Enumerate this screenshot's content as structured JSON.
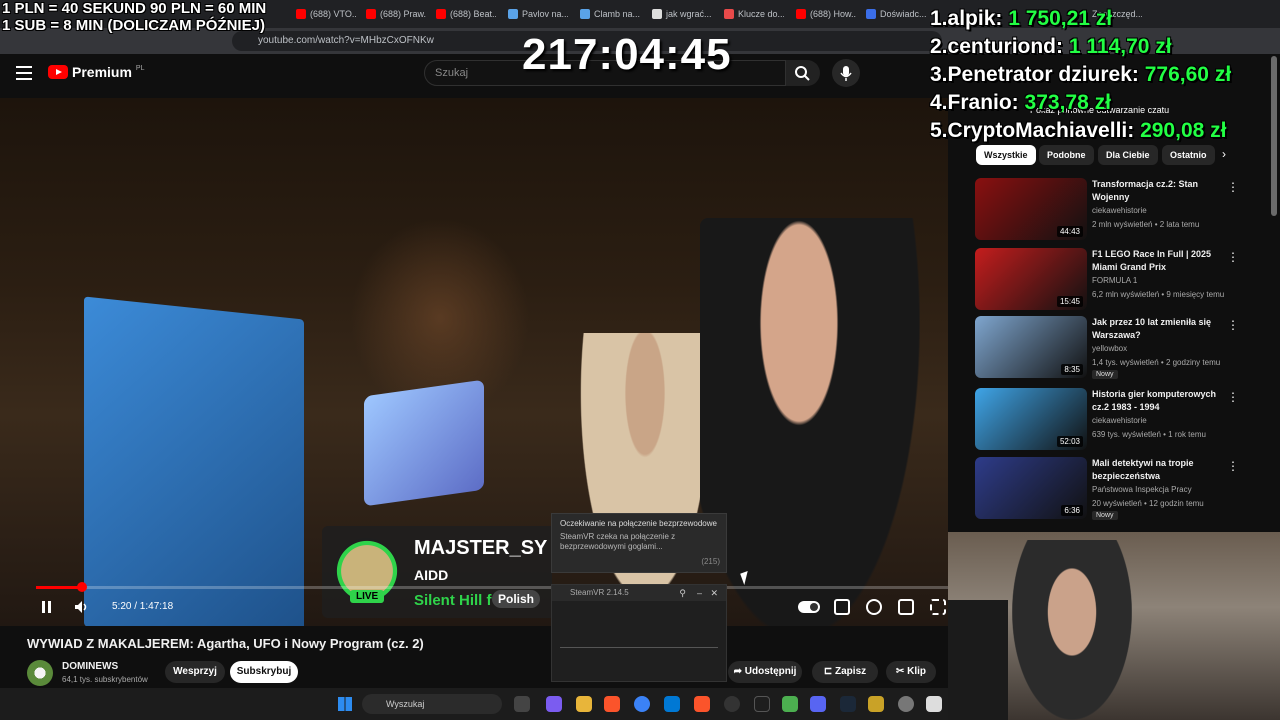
{
  "browser": {
    "tabs": [
      "(688) VTO...",
      "(688) Praw...",
      "(688) Beat...",
      "Pavlov na...",
      "Clamb na...",
      "jak wgrać...",
      "Klucze do...",
      "(688) How...",
      "Doświadc...",
      "Zaoszczęd..."
    ],
    "url": "youtube.com/watch?v=MHbzCxOFNKw"
  },
  "overlay": {
    "donation_rule_1": "1 PLN =  40 SEKUND 90 PLN = 60 MIN",
    "donation_rule_2": "1 SUB = 8 MIN (DOLICZAM PÓŹNIEJ)",
    "timer": "217:04:45",
    "leaderboard": [
      {
        "rank": "1.",
        "name": "alpik:",
        "amount": "1 750,21 zł"
      },
      {
        "rank": "2.",
        "name": "centuriond:",
        "amount": "1 114,70 zł"
      },
      {
        "rank": "3.",
        "name": "Penetrator dziurek:",
        "amount": "776,60 zł"
      },
      {
        "rank": "4.",
        "name": "Franio:",
        "amount": "373,78 zł"
      },
      {
        "rank": "5.",
        "name": "CryptoMachiavelli:",
        "amount": "290,08 zł"
      }
    ]
  },
  "youtube": {
    "logo_text": "Premium",
    "logo_region": "PL",
    "search_placeholder": "Szukaj",
    "replay_chat": "Pokaż ponowne odtwarzanie czatu",
    "chips": [
      "Wszystkie",
      "Podobne",
      "Dla Ciebie",
      "Ostatnio"
    ]
  },
  "music_widget": {
    "title": "MAJSTER_SY",
    "artist": "AIDD",
    "song": "Silent Hill f",
    "language": "Polish",
    "live": "LIVE"
  },
  "steam_notification": {
    "title": "Oczekiwanie na połączenie bezprzewodowe",
    "body": "SteamVR czeka na połączenie z bezprzewodowymi goglami...",
    "count": "(215)"
  },
  "steamvr": {
    "title": "SteamVR 2.14.5"
  },
  "player": {
    "time": "5:20 / 1:47:18",
    "progress_fraction": 0.05
  },
  "video": {
    "title": "WYWIAD Z MAKALJEREM: Agartha, UFO i Nowy Program (cz. 2)",
    "channel": "DOMINEWS",
    "subscribers": "64,1 tys. subskrybentów",
    "support_label": "Wesprzyj",
    "subscribe_label": "Subskrybuj",
    "share_label": "Udostępnij",
    "save_label": "Zapisz",
    "clip_label": "Klip"
  },
  "recommendations": [
    {
      "title": "Transformacja cz.2: Stan Wojenny",
      "channel": "ciekawehistorie",
      "meta": "2 mln wyświetleń • 2 lata temu",
      "duration": "44:43",
      "color": "#8a1010",
      "new": ""
    },
    {
      "title": "F1 LEGO Race In Full | 2025 Miami Grand Prix",
      "channel": "FORMULA 1",
      "meta": "6,2 mln wyświetleń • 9 miesięcy temu",
      "duration": "15:45",
      "color": "#c41d1d",
      "new": ""
    },
    {
      "title": "Jak przez 10 lat zmieniła się Warszawa?",
      "channel": "yellowbox",
      "meta": "1,4 tys. wyświetleń • 2 godziny temu",
      "duration": "8:35",
      "color": "#7fa6cf",
      "new": "Nowy"
    },
    {
      "title": "Historia gier komputerowych cz.2 1983 - 1994",
      "channel": "ciekawehistorie",
      "meta": "639 tys. wyświetleń • 1 rok temu",
      "duration": "52:03",
      "color": "#3fa5e8",
      "new": ""
    },
    {
      "title": "Mali detektywi na tropie bezpieczeństwa",
      "channel": "Państwowa Inspekcja Pracy",
      "meta": "20 wyświetleń • 12 godzin temu",
      "duration": "6:36",
      "color": "#2e3c8a",
      "new": "Nowy"
    }
  ],
  "taskbar": {
    "search_placeholder": "Wyszukaj"
  }
}
